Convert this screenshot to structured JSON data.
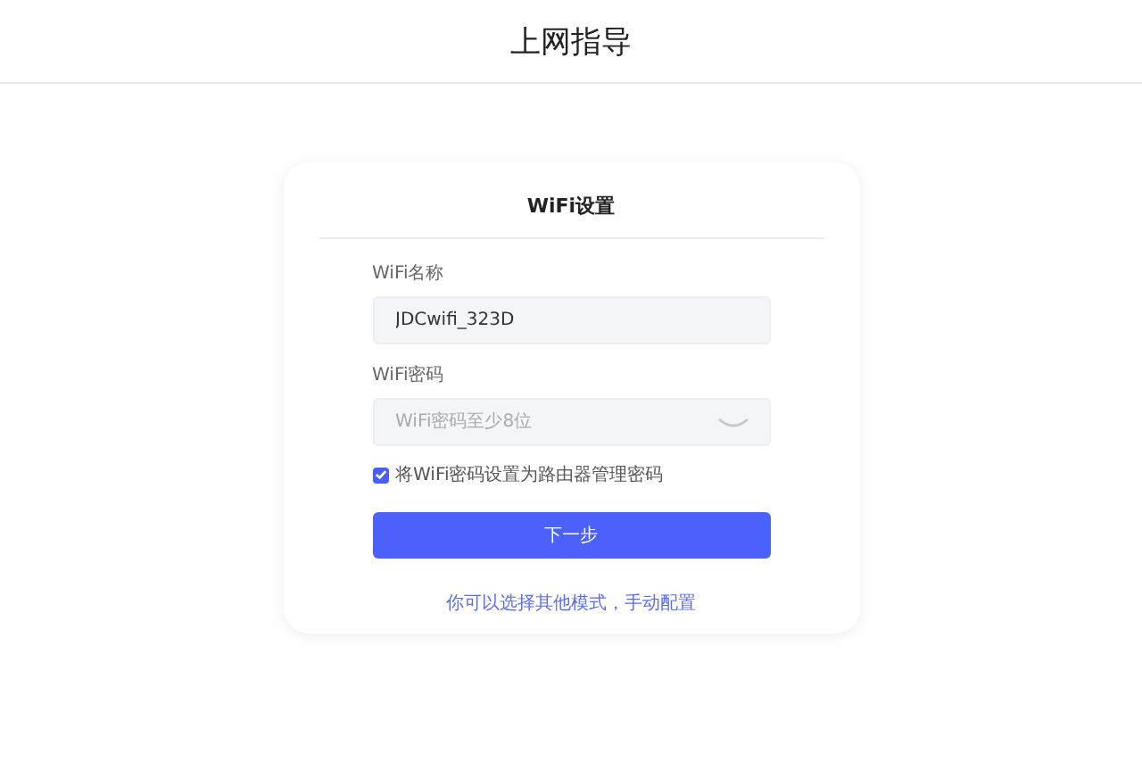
{
  "header": {
    "title": "上网指导"
  },
  "card": {
    "title": "WiFi设置",
    "fields": [
      {
        "label": "WiFi名称",
        "value": "JDCwifi_323D",
        "kind": "text"
      },
      {
        "label": "WiFi密码",
        "placeholder": "WiFi密码至少8位",
        "kind": "password"
      }
    ],
    "checkbox": {
      "label": "将WiFi密码设置为路由器管理密码",
      "checked": true
    },
    "button": "下一步",
    "link": "你可以选择其他模式，手动配置"
  }
}
